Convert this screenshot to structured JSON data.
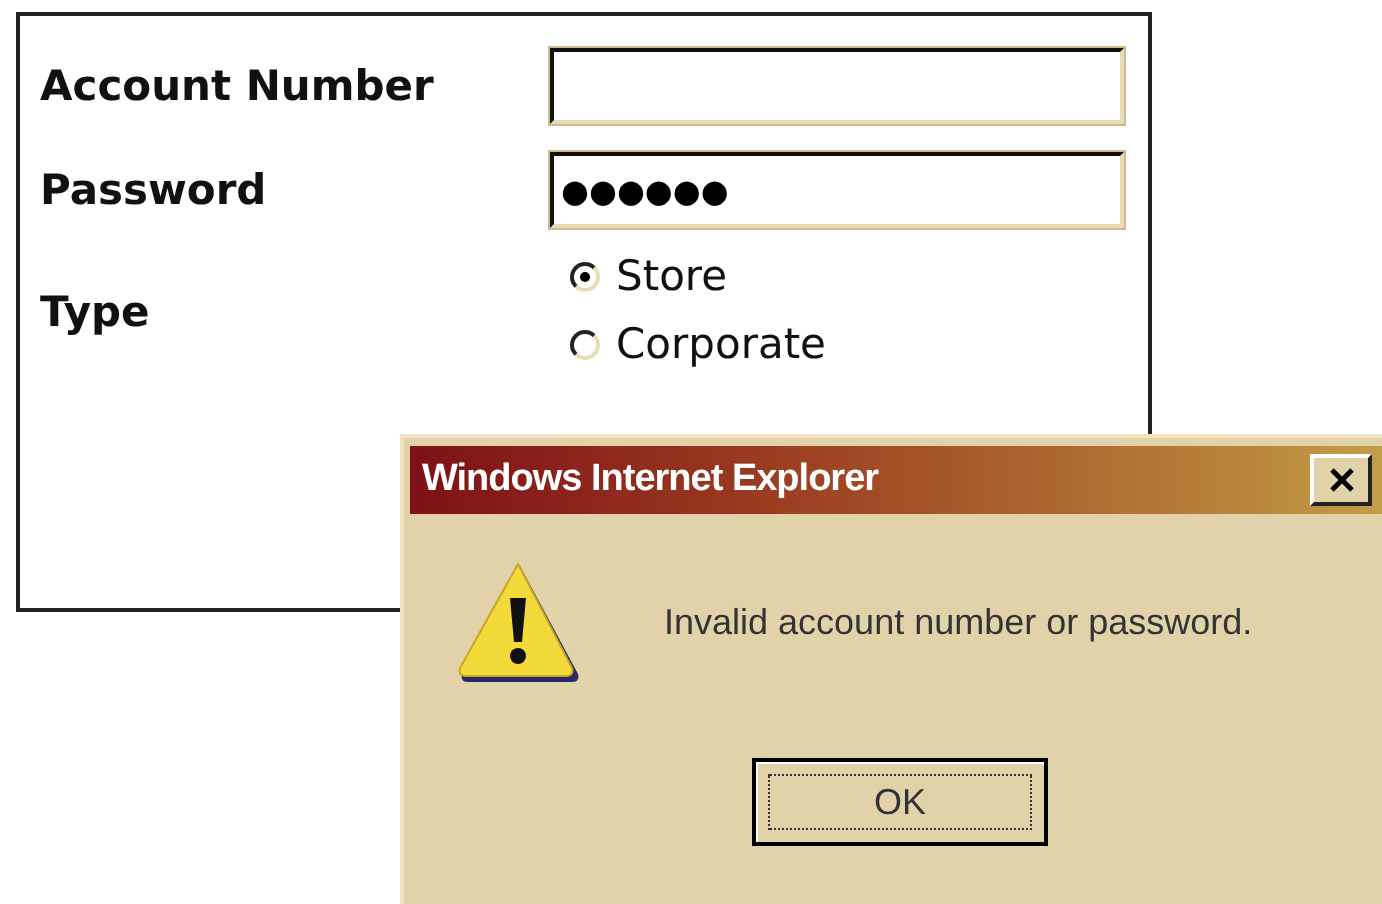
{
  "form": {
    "fields": [
      {
        "label": "Account Number"
      },
      {
        "label": "Password",
        "value": "●●●●●●"
      }
    ],
    "type": {
      "label": "Type",
      "options": [
        {
          "label": "Store",
          "selected": true
        },
        {
          "label": "Corporate",
          "selected": false
        }
      ]
    }
  },
  "dialog": {
    "title": "Windows Internet Explorer",
    "message": "Invalid account number or password.",
    "button": "OK"
  }
}
